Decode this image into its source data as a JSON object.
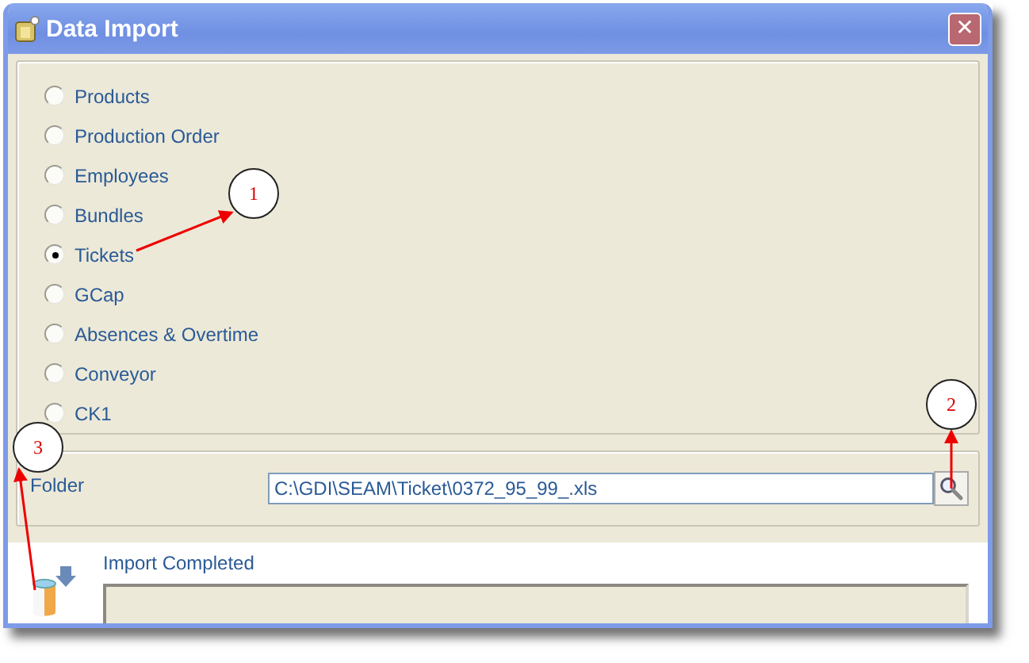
{
  "window": {
    "title": "Data Import",
    "close": "✕"
  },
  "options": [
    {
      "label": "Products",
      "selected": false
    },
    {
      "label": "Production Order",
      "selected": false
    },
    {
      "label": "Employees",
      "selected": false
    },
    {
      "label": "Bundles",
      "selected": false
    },
    {
      "label": "Tickets",
      "selected": true
    },
    {
      "label": "GCap",
      "selected": false
    },
    {
      "label": "Absences & Overtime",
      "selected": false
    },
    {
      "label": "Conveyor",
      "selected": false
    },
    {
      "label": "CK1",
      "selected": false
    }
  ],
  "folder": {
    "label": "Folder",
    "value": "C:\\GDI\\SEAM\\Ticket\\0372_95_99_.xls"
  },
  "status": {
    "message": "Import Completed",
    "progress": {
      "level": 0
    }
  },
  "callouts": [
    "1",
    "2",
    "3"
  ]
}
